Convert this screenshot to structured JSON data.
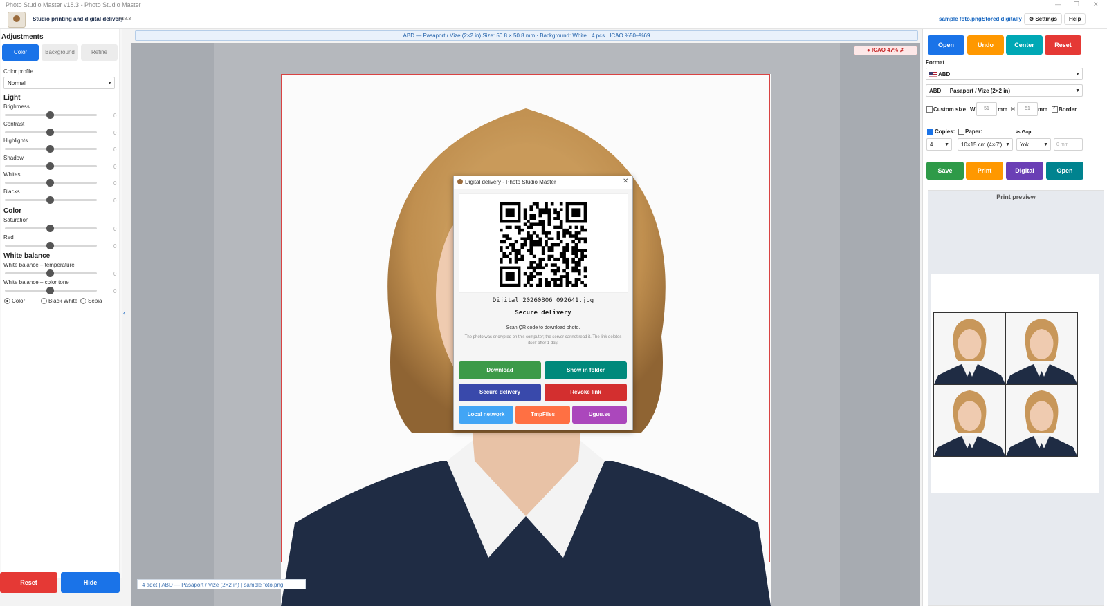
{
  "window": {
    "title": "Photo Studio Master v18.3 - Photo Studio Master"
  },
  "header": {
    "tagline": "Studio printing and digital delivery",
    "version": "v18.3",
    "file_name": "sample foto.png",
    "stored_status": "Stored digitally",
    "settings_label": "Settings",
    "help_label": "Help"
  },
  "adjustments": {
    "title": "Adjustments",
    "tabs": [
      "Color",
      "Background",
      "Refine"
    ],
    "color_profile_label": "Color profile",
    "color_profile_value": "Normal",
    "light_heading": "Light",
    "light_sliders": [
      {
        "label": "Brightness",
        "value": "0"
      },
      {
        "label": "Contrast",
        "value": "0"
      },
      {
        "label": "Highlights",
        "value": "0"
      },
      {
        "label": "Shadow",
        "value": "0"
      },
      {
        "label": "Whites",
        "value": "0"
      },
      {
        "label": "Blacks",
        "value": "0"
      }
    ],
    "color_heading": "Color",
    "color_sliders": [
      {
        "label": "Saturation",
        "value": "0"
      },
      {
        "label": "Red",
        "value": "0"
      }
    ],
    "wb_heading": "White balance",
    "wb_sliders": [
      {
        "label": "White balance – temperature",
        "value": "0"
      },
      {
        "label": "White balance – color tone",
        "value": "0"
      }
    ],
    "mode_options": [
      "Color",
      "Black  White",
      "Sepia"
    ],
    "mode_selected": "Color",
    "reset_label": "Reset",
    "hide_label": "Hide"
  },
  "canvas": {
    "info": "ABD — Pasaport / Vize (2×2 in) Size: 50.8 × 50.8 mm · Background: White · 4 pcs · ICAO %50–%69",
    "icao_badge": "● ICAO 47%  ✗",
    "status": "4 adet | ABD — Pasaport / Vize (2×2 in) | sample foto.png"
  },
  "dialog": {
    "title": "Digital delivery - Photo Studio Master",
    "filename": "Dijital_20260806_092641.jpg",
    "delivery_title": "Secure delivery",
    "instruction": "Scan QR code to download photo.",
    "note": "The photo was encrypted on this computer; the server cannot read it. The link deletes itself after 1 day.",
    "buttons": {
      "download": "Download",
      "show_in_folder": "Show in folder",
      "secure_delivery": "Secure delivery",
      "revoke_link": "Revoke link",
      "local_network": "Local network",
      "tmpfiles": "TmpFiles",
      "uguu": "Uguu.se"
    }
  },
  "right": {
    "top_buttons": [
      "Open",
      "Undo",
      "Center",
      "Reset"
    ],
    "format_label": "Format",
    "country": "ABD",
    "format_value": "ABD — Pasaport / Vize (2×2 in)",
    "custom_size_label": "Custom size",
    "w_label": "W",
    "w_value": "51",
    "h_label": "H",
    "h_value": "51",
    "unit": "mm",
    "border_label": "Border",
    "copies_label": "Copies:",
    "paper_label": "Paper:",
    "gap_label": "✂ Gap",
    "copies_value": "4",
    "paper_value": "10×15 cm (4×6\")",
    "gap_value": "Yok",
    "gap_mm": "0 mm",
    "action_buttons": [
      "Save",
      "Print",
      "Digital",
      "Open"
    ],
    "preview_title": "Print preview"
  },
  "colors": {
    "blue": "#1a73e8",
    "orange": "#ff9800",
    "teal": "#00a8b5",
    "red": "#e53935",
    "green": "#2e9a48",
    "purple": "#6a3fb5",
    "dark_teal": "#00838f"
  }
}
